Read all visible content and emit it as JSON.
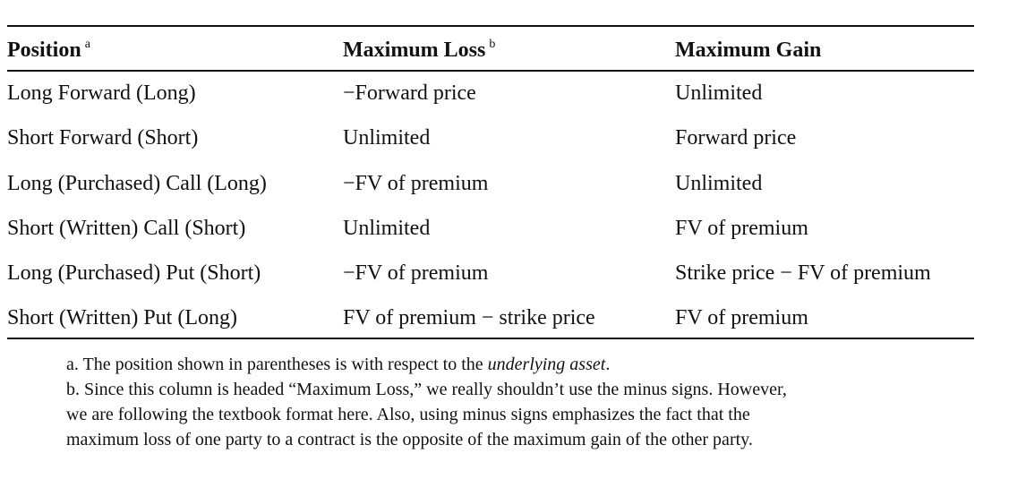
{
  "table": {
    "headers": [
      {
        "label": "Position",
        "sup": "a"
      },
      {
        "label": "Maximum Loss",
        "sup": "b"
      },
      {
        "label": "Maximum Gain",
        "sup": ""
      }
    ],
    "rows": [
      [
        "Long Forward (Long)",
        "−Forward price",
        "Unlimited"
      ],
      [
        "Short Forward (Short)",
        "Unlimited",
        "Forward price"
      ],
      [
        "Long (Purchased) Call (Long)",
        "−FV of premium",
        "Unlimited"
      ],
      [
        "Short (Written) Call (Short)",
        "Unlimited",
        "FV of premium"
      ],
      [
        "Long (Purchased) Put (Short)",
        "−FV of premium",
        "Strike price − FV of premium"
      ],
      [
        "Short (Written) Put (Long)",
        "FV of premium − strike price",
        "FV of premium"
      ]
    ]
  },
  "notes": {
    "a_text": "a. The position shown in parentheses is with respect to the ",
    "a_emph": "underlying asset",
    "a_end": ".",
    "b_lines": [
      "b. Since this column is headed “Maximum Loss,” we really shouldn’t use the minus signs. However,",
      "we are following the textbook format here. Also, using minus signs emphasizes the fact that the",
      "maximum loss of one party to a contract is the opposite of the maximum gain of the other party."
    ]
  }
}
